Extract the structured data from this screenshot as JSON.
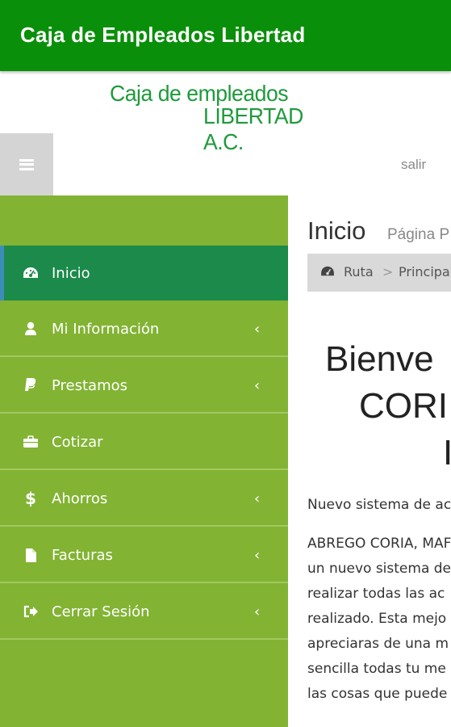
{
  "app": {
    "title": "Caja de Empleados Libertad"
  },
  "logo": {
    "line1": "Caja de empleados",
    "line2": "LIBERTAD A.C."
  },
  "topnav": {
    "logout": "salir"
  },
  "sidebar": {
    "items": [
      {
        "label": "Inicio",
        "icon": "dashboard-icon",
        "active": true
      },
      {
        "label": "Mi Información",
        "icon": "user-icon",
        "submenu": true
      },
      {
        "label": "Prestamos",
        "icon": "paypal-icon",
        "submenu": true
      },
      {
        "label": "Cotizar",
        "icon": "briefcase-icon"
      },
      {
        "label": "Ahorros",
        "icon": "dollar-icon",
        "submenu": true
      },
      {
        "label": "Facturas",
        "icon": "file-icon",
        "submenu": true
      },
      {
        "label": "Cerrar Sesión",
        "icon": "sign-out-icon",
        "submenu": true
      }
    ],
    "chevron": "‹"
  },
  "content": {
    "title": "Inicio",
    "subtitle": "Página P",
    "breadcrumb": {
      "root": "Ruta",
      "separator": ">",
      "current": "Principa"
    },
    "welcome": {
      "line1": "Bienve",
      "line2": "CORI",
      "line3": "I"
    },
    "paragraph1": "Nuevo sistema de ac",
    "paragraph2": [
      "ABREGO CORIA, MAF",
      "un nuevo sistema de",
      "realizar todas las ac",
      "realizado. Esta mejo",
      "apreciaras de una m",
      "sencilla todas tu me",
      "las cosas que puede"
    ]
  },
  "colors": {
    "appbar": "#0a8f0a",
    "sidebar": "#82b333",
    "sidebar_active": "#1b8a4b",
    "active_indicator": "#3c8dbc",
    "logo": "#1f9a3c"
  }
}
